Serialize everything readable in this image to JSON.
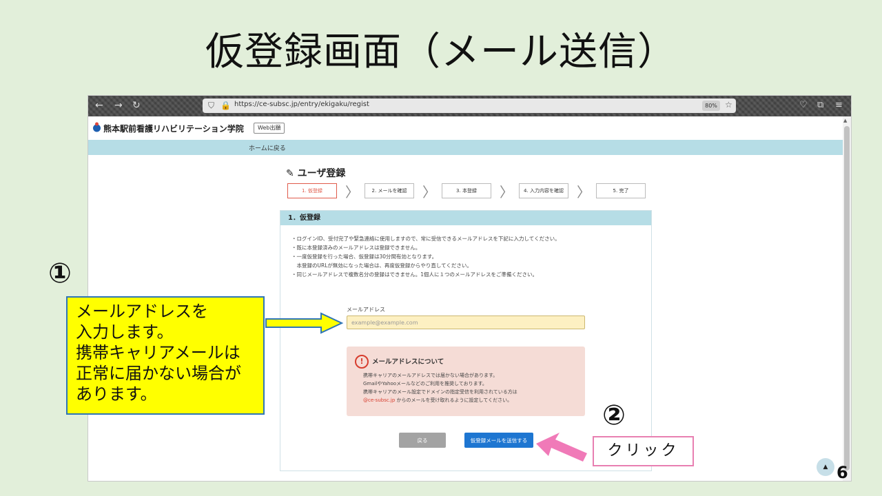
{
  "slide": {
    "title": "仮登録画面（メール送信）",
    "page_number": "6",
    "marker_1": "①",
    "marker_2": "②",
    "callout_lines": [
      "メールアドレスを",
      "入力します。",
      "携帯キャリアメールは",
      "正常に届かない場合が",
      "あります。"
    ],
    "click_label": "クリック"
  },
  "browser": {
    "url": "https://ce-subsc.jp/entry/ekigaku/regist",
    "zoom": "80%"
  },
  "site": {
    "school_name": "熊本駅前看護リハビリテーション学院",
    "web_badge": "Web出願",
    "nav_link": "ホームに戻る"
  },
  "page": {
    "heading": "ユーザ登録",
    "steps": [
      "1. 仮登録",
      "2. メールを確認",
      "3. 本登録",
      "4. 入力内容を確認",
      "5. 完了"
    ],
    "active_step": 0,
    "panel_title": "1．仮登録",
    "notes": [
      "・ログインID、受付完了や緊急連絡に使用しますので、常に受信できるメールアドレスを下記に入力してください。",
      "・既に本登録済みのメールアドレスは登録できません。",
      "・一度仮登録を行った場合、仮登録は30分間有効となります。",
      "　本登録のURLが無効になった場合は、再度仮登録からやり直してください。",
      "・同じメールアドレスで複数名分の登録はできません。1個人に１つのメールアドレスをご準備ください。"
    ],
    "email_label": "メールアドレス",
    "email_placeholder": "example@example.com",
    "email_value": "",
    "warning": {
      "title": "メールアドレスについて",
      "line1": "携帯キャリアのメールアドレスでは届かない場合があります。",
      "line2": "GmailやYahooメールなどのご利用を推奨しております。",
      "line3": "携帯キャリアのメール設定でドメインの指定受信を利用されている方は",
      "line4_link": "@ce-subsc.jp",
      "line4_rest": " からのメールを受け取れるように設定してください。"
    },
    "back_button": "戻る",
    "send_button": "仮登録メールを送信する",
    "scroll_top": "▲"
  },
  "colors": {
    "slide_bg": "#e2efda",
    "header_band": "#b6dde6",
    "active_step": "#e05a4a",
    "send_button": "#1e76d1",
    "callout_bg": "#ffff00",
    "arrow_pink": "#f07ab8"
  },
  "icons": [
    "back-arrow-icon",
    "forward-arrow-icon",
    "reload-icon",
    "shield-icon",
    "lock-icon",
    "star-icon",
    "pocket-icon",
    "extensions-icon",
    "menu-icon",
    "edit-icon",
    "warning-icon"
  ]
}
